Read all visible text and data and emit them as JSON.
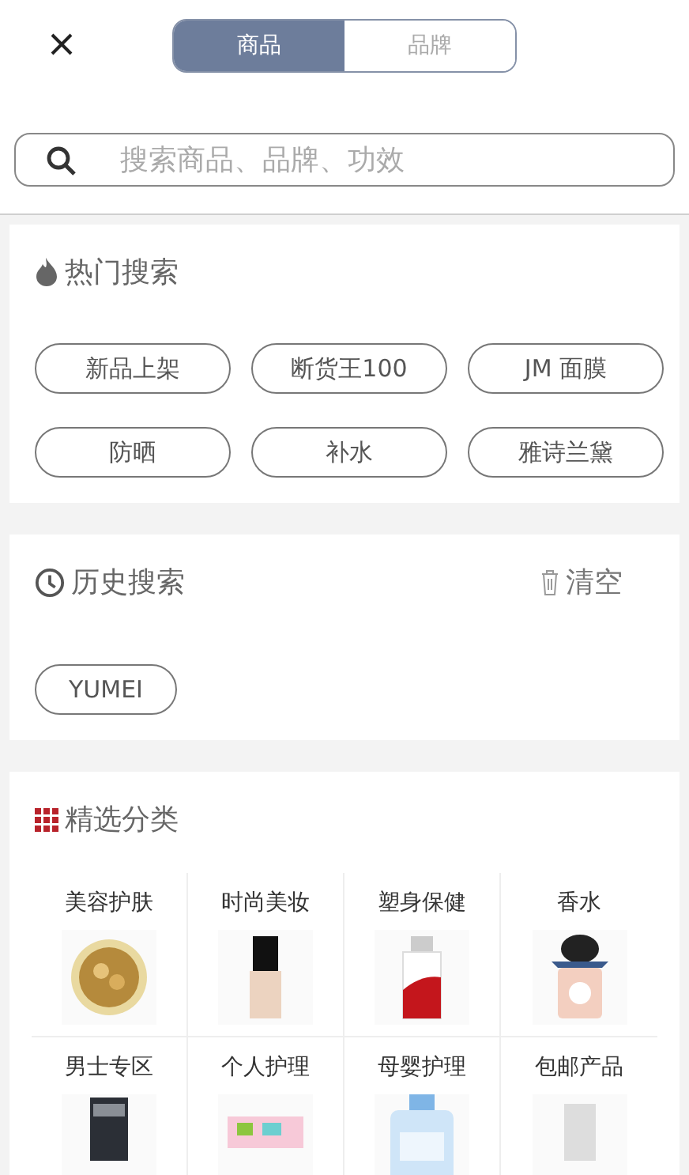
{
  "tabs": [
    {
      "label": "商品",
      "selected": true
    },
    {
      "label": "品牌",
      "selected": false
    }
  ],
  "search": {
    "placeholder": "搜索商品、品牌、功效"
  },
  "hot_search": {
    "title": "热门搜索",
    "tags": [
      "新品上架",
      "断货王100",
      "JM 面膜",
      "防晒",
      "补水",
      "雅诗兰黛"
    ]
  },
  "history": {
    "title": "历史搜索",
    "clear": "清空",
    "tags": [
      "YUMEI"
    ]
  },
  "categories": {
    "title": "精选分类",
    "items": [
      {
        "label": "美容护肤",
        "kind": "picture"
      },
      {
        "label": "时尚美妆",
        "kind": "picture"
      },
      {
        "label": "塑身保健",
        "kind": "picture"
      },
      {
        "label": "香水",
        "kind": "picture"
      },
      {
        "label": "男士专区",
        "kind": "picture"
      },
      {
        "label": "个人护理",
        "kind": "picture"
      },
      {
        "label": "母婴护理",
        "kind": "picture"
      },
      {
        "label": "包邮产品",
        "kind": "picture"
      }
    ]
  }
}
